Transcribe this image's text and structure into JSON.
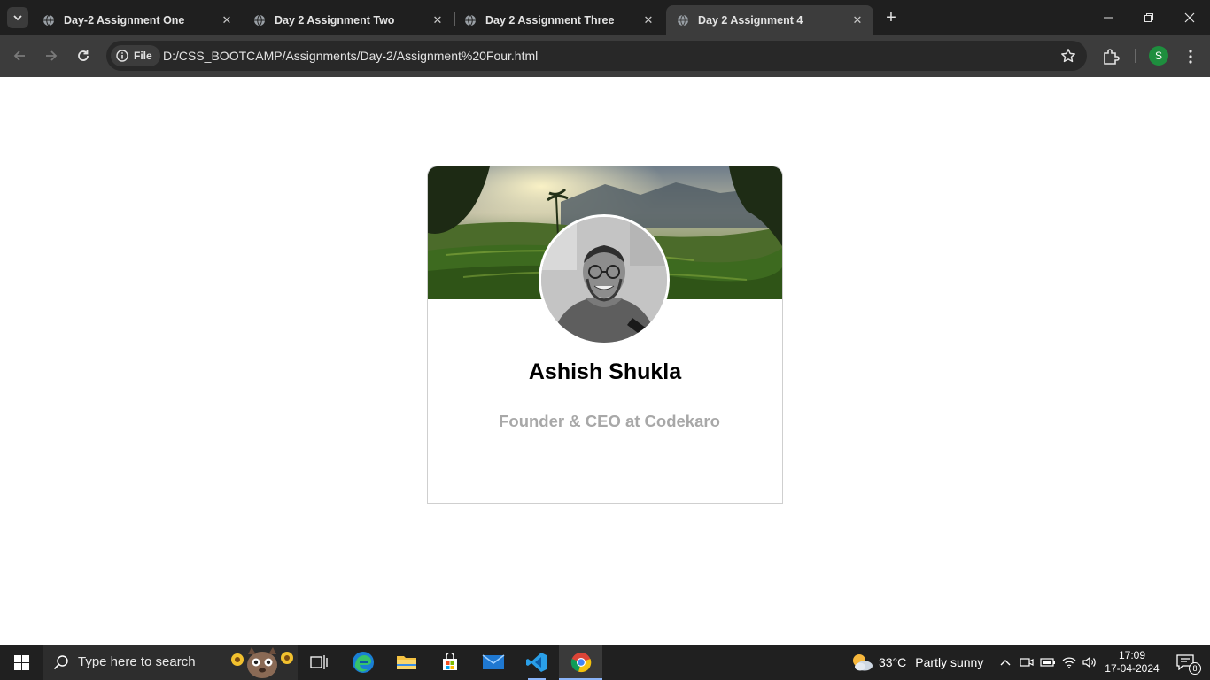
{
  "browser": {
    "tabs": [
      {
        "title": "Day-2 Assignment One",
        "active": false
      },
      {
        "title": "Day 2 Assignment Two",
        "active": false
      },
      {
        "title": "Day 2 Assignment Three",
        "active": false
      },
      {
        "title": "Day 2 Assignment 4",
        "active": true
      }
    ],
    "new_tab_label": "+",
    "chip_label": "File",
    "url": "D:/CSS_BOOTCAMP/Assignments/Day-2/Assignment%20Four.html",
    "profile_initial": "S"
  },
  "card": {
    "name": "Ashish Shukla",
    "role": "Founder & CEO at Codekaro"
  },
  "taskbar": {
    "search_placeholder": "Type here to search",
    "weather_temp": "33°C",
    "weather_desc": "Partly sunny",
    "time": "17:09",
    "date": "17-04-2024",
    "notification_count": "8"
  },
  "colors": {
    "tabstrip_bg": "#1f1f1f",
    "toolbar_bg": "#3c3c3c",
    "role_text": "#a8a8a8",
    "taskbar_bg": "#202020"
  }
}
